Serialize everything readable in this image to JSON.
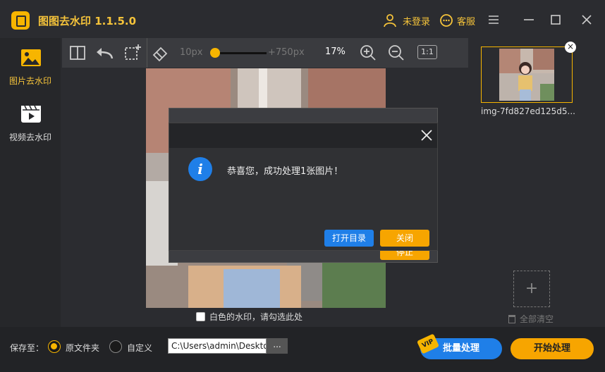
{
  "app": {
    "title": "图图去水印  1.1.5.0",
    "login_label": "未登录",
    "service_label": "客服"
  },
  "sidebar": {
    "items": [
      {
        "label": "图片去水印",
        "icon": "image-icon",
        "active": true
      },
      {
        "label": "视频去水印",
        "icon": "video-icon",
        "active": false
      }
    ]
  },
  "toolbar": {
    "brush_min": "10px",
    "brush_max": "+750px",
    "zoom": "17%",
    "ratio_label": "1:1"
  },
  "canvas": {
    "white_watermark_label": "白色的水印，请勾选此处",
    "white_watermark_checked": false
  },
  "files": {
    "items": [
      {
        "name": "img-7fd827ed125d5..."
      }
    ],
    "clear_all": "全部清空"
  },
  "bottom": {
    "save_to_label": "保存至：",
    "options": [
      {
        "label": "原文件夹",
        "selected": true
      },
      {
        "label": "自定义",
        "selected": false
      }
    ],
    "path": "C:\\Users\\admin\\Desktop",
    "browse_label": "...",
    "vip_badge": "VIP",
    "batch_label": "批量处理",
    "start_label": "开始处理"
  },
  "back_dialog": {
    "button_label": "停止"
  },
  "dialog": {
    "message": "恭喜您，成功处理1张图片！",
    "open_dir_label": "打开目录",
    "close_label": "关闭"
  },
  "colors": {
    "accent": "#f7b500",
    "primary_blue": "#1f7fe8",
    "background": "#2b2c30"
  }
}
